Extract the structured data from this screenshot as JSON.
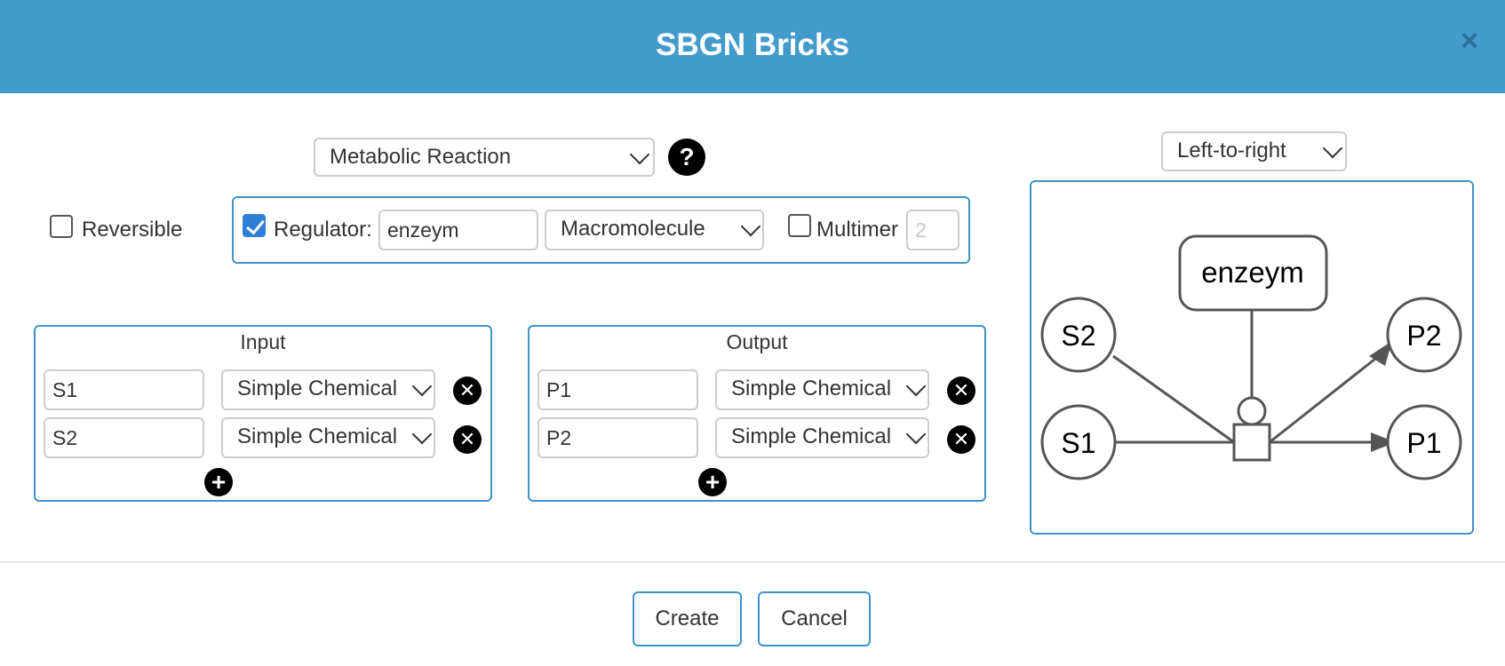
{
  "dialog": {
    "title": "SBGN Bricks",
    "close_icon": "close-icon"
  },
  "template_select": {
    "value": "Metabolic Reaction",
    "help_glyph": "?"
  },
  "orientation_select": {
    "value": "Left-to-right"
  },
  "reversible": {
    "label": "Reversible",
    "checked": false
  },
  "regulator": {
    "checked": true,
    "label": "Regulator:",
    "name_value": "enzeym",
    "type_value": "Macromolecule",
    "multimer_label": "Multimer",
    "multimer_checked": false,
    "multimer_count": "2"
  },
  "input": {
    "title": "Input",
    "rows": [
      {
        "name": "S1",
        "type": "Simple Chemical"
      },
      {
        "name": "S2",
        "type": "Simple Chemical"
      }
    ]
  },
  "output": {
    "title": "Output",
    "rows": [
      {
        "name": "P1",
        "type": "Simple Chemical"
      },
      {
        "name": "P2",
        "type": "Simple Chemical"
      }
    ]
  },
  "preview": {
    "regulator_label": "enzeym",
    "inputs": [
      "S2",
      "S1"
    ],
    "outputs": [
      "P2",
      "P1"
    ]
  },
  "footer": {
    "create_label": "Create",
    "cancel_label": "Cancel"
  },
  "colors": {
    "header": "#439bcc",
    "panel_border": "#3f93c7",
    "checkbox": "#2f7fd8"
  }
}
